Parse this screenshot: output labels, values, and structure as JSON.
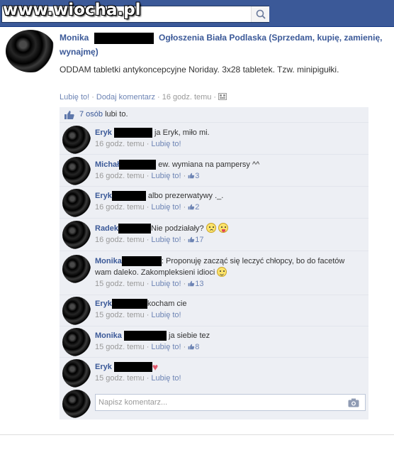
{
  "search": {
    "placeholder": "W"
  },
  "watermark": "www.wiocha.pl",
  "post": {
    "author": "Monika",
    "group": "Ogłoszenia Biała Podlaska (Sprzedam, kupię, zamienię, wynajmę)",
    "text": "ODDAM tabletki antykoncepcyjne Noriday. 3x28 tabletek. Tzw. minipigułki.",
    "like_label": "Lubię to!",
    "comment_label": "Dodaj komentarz",
    "time": "16 godz. temu"
  },
  "likes": {
    "count": "7 osób",
    "suffix": "lubi to."
  },
  "comments": [
    {
      "name": "Eryk",
      "text": "ja Eryk, miło mi.",
      "time": "16 godz. temu",
      "like": "Lubię to!",
      "likes": ""
    },
    {
      "name": "Michał",
      "text": "ew. wymiana na pampersy ^^",
      "time": "16 godz. temu",
      "like": "Lubię to!",
      "likes": "3"
    },
    {
      "name": "Eryk",
      "text": "albo prezerwatywy ._.",
      "time": "16 godz. temu",
      "like": "Lubię to!",
      "likes": "2"
    },
    {
      "name": "Radek",
      "text": "Nie podziałały?",
      "time": "16 godz. temu",
      "like": "Lubię to!",
      "likes": "17"
    },
    {
      "name": "Monika",
      "text": ": Proponuję zacząć się leczyć chłopcy, bo do facetów wam daleko. Zakompleksieni idioci",
      "time": "15 godz. temu",
      "like": "Lubię to!",
      "likes": "13"
    },
    {
      "name": "Eryk",
      "text": "kocham cie",
      "time": "15 godz. temu",
      "like": "Lubię to!",
      "likes": ""
    },
    {
      "name": "Monika",
      "text": "ja siebie tez",
      "time": "15 godz. temu",
      "like": "Lubię to!",
      "likes": "8"
    },
    {
      "name": "Eryk",
      "text": "",
      "time": "15 godz. temu",
      "like": "Lubię to!",
      "likes": ""
    }
  ],
  "comment_box": {
    "placeholder": "Napisz komentarz..."
  },
  "icons": [
    "search-icon",
    "thumbs-up-icon",
    "camera-icon",
    "heart-icon",
    "globe-icon"
  ],
  "colors": {
    "brand": "#3b5998",
    "link": "#6d84b4",
    "panel": "#edeff4"
  }
}
